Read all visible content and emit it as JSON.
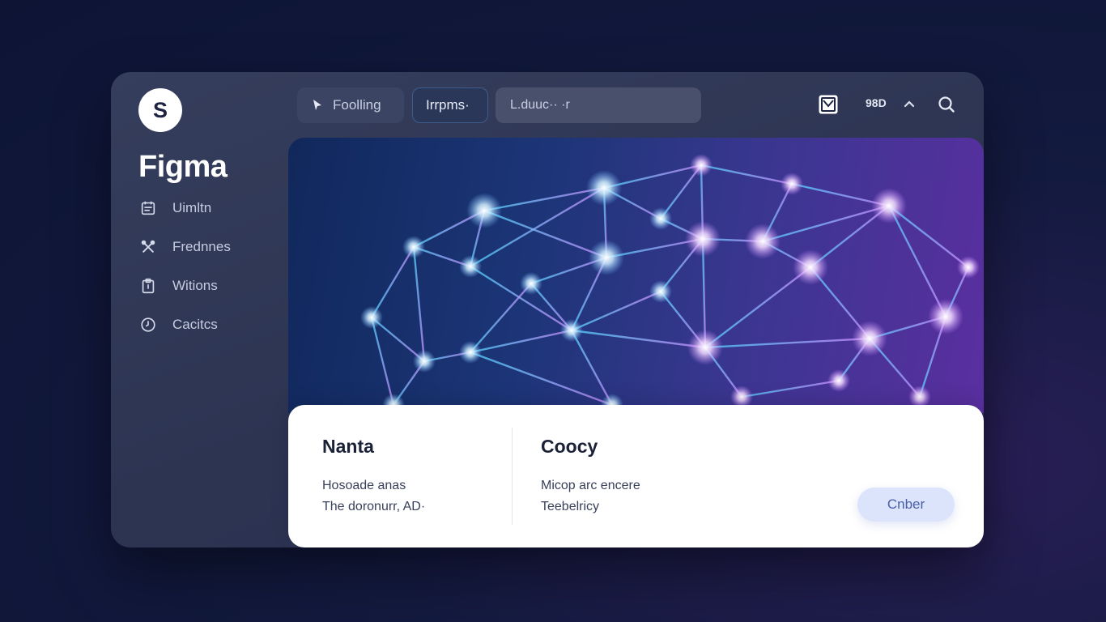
{
  "app": {
    "logo_letter": "S",
    "brand": "Figma"
  },
  "sidebar": {
    "items": [
      {
        "label": "Uimltn",
        "icon": "calendar-icon"
      },
      {
        "label": "Frednnes",
        "icon": "tools-icon"
      },
      {
        "label": "Witions",
        "icon": "clipboard-icon"
      },
      {
        "label": "Cacitcs",
        "icon": "clock-icon"
      }
    ]
  },
  "toolbar": {
    "pill_1_label": "Foolling",
    "pill_2_label": "Irrpms·",
    "search_value": "L.duuc·· ·r",
    "status_text": "98D"
  },
  "card": {
    "left": {
      "title": "Nanta",
      "line_1": "Hosoade anas",
      "line_2": "The doronurr,  AD·"
    },
    "right": {
      "title": "Coocy",
      "line_1": "Micop arc encere",
      "line_2": "Teebelricy"
    },
    "button_label": "Cnber"
  },
  "colors": {
    "background": "#131a3f",
    "window": "#2f3754",
    "accent_blue": "#4fd6ff",
    "accent_purple": "#c784ff",
    "button_bg": "#dbe4fb"
  }
}
